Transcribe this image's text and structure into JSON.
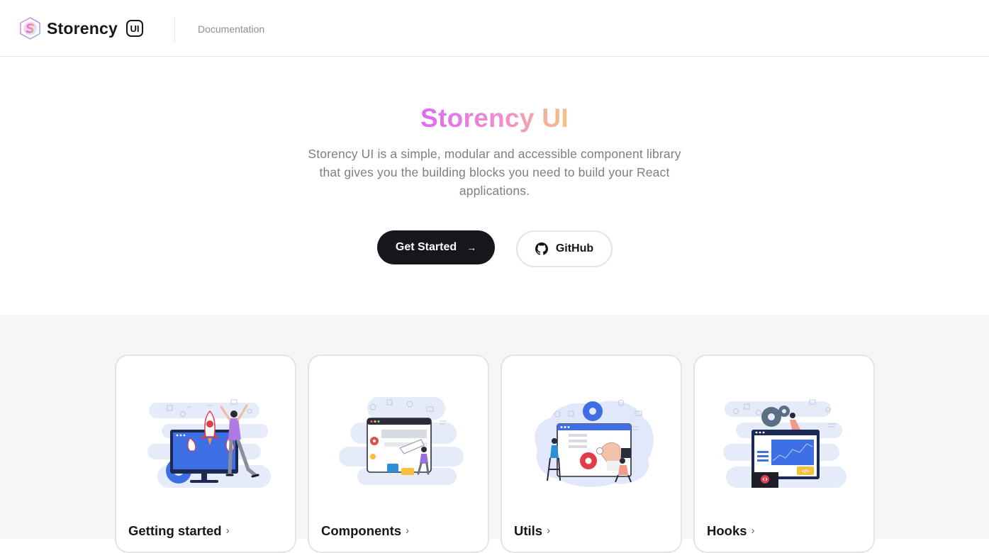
{
  "header": {
    "brand_name": "Storency",
    "brand_badge": "UI",
    "logo_icon": "storency-hex-logo",
    "nav": {
      "documentation": "Documentation"
    }
  },
  "hero": {
    "title": "Storency UI",
    "description": "Storency UI is a simple, modular and accessible component library that gives you the building blocks you need to build your React applications.",
    "primary_button": "Get Started",
    "primary_button_icon": "arrow-right-icon",
    "secondary_button": "GitHub",
    "secondary_button_icon": "github-icon"
  },
  "cards": [
    {
      "title": "Getting started",
      "illustration": "rocket-launch-illustration"
    },
    {
      "title": "Components",
      "illustration": "browser-components-illustration"
    },
    {
      "title": "Utils",
      "illustration": "gear-tools-illustration"
    },
    {
      "title": "Hooks",
      "illustration": "analytics-hooks-illustration"
    }
  ],
  "colors": {
    "text_dark": "#16161d",
    "text_muted": "#7c7e89",
    "nav_muted": "#8b8d98",
    "gradient_start": "#dc6cf2",
    "gradient_end": "#f6c27f",
    "section_bg": "#f6f6f6",
    "border": "#e4e4e8"
  }
}
